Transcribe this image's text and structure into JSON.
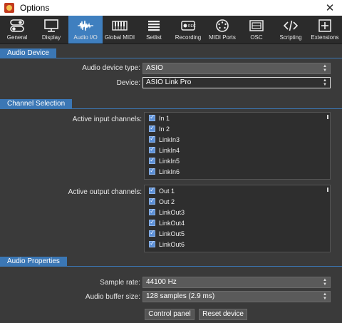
{
  "window": {
    "title": "Options",
    "close_icon": "close-icon"
  },
  "toolbar": {
    "items": [
      {
        "label": "General",
        "icon": "toggles-icon"
      },
      {
        "label": "Display",
        "icon": "monitor-icon"
      },
      {
        "label": "Audio I/O",
        "icon": "waveform-icon"
      },
      {
        "label": "Global MIDI",
        "icon": "keyboard-icon"
      },
      {
        "label": "Setlist",
        "icon": "list-icon"
      },
      {
        "label": "Recording",
        "icon": "record-icon"
      },
      {
        "label": "MIDI Ports",
        "icon": "midi-port-icon"
      },
      {
        "label": "OSC",
        "icon": "osc-icon"
      },
      {
        "label": "Scripting",
        "icon": "code-icon"
      },
      {
        "label": "Extensions",
        "icon": "plus-box-icon"
      }
    ],
    "active_index": 2,
    "accent": "#3f7fbf"
  },
  "audio_device": {
    "header": "Audio Device",
    "type_label": "Audio device type:",
    "type_value": "ASIO",
    "device_label": "Device:",
    "device_value": "ASIO Link Pro"
  },
  "channel_selection": {
    "header": "Channel Selection",
    "input_label": "Active input channels:",
    "inputs": [
      "In 1",
      "In 2",
      "LinkIn3",
      "LinkIn4",
      "LinkIn5",
      "LinkIn6"
    ],
    "output_label": "Active output channels:",
    "outputs": [
      "Out 1",
      "Out 2",
      "LinkOut3",
      "LinkOut4",
      "LinkOut5",
      "LinkOut6"
    ]
  },
  "audio_properties": {
    "header": "Audio Properties",
    "sample_rate_label": "Sample rate:",
    "sample_rate_value": "44100 Hz",
    "buffer_label": "Audio buffer size:",
    "buffer_value": "128 samples (2.9 ms)",
    "control_panel_label": "Control panel",
    "reset_label": "Reset device"
  }
}
